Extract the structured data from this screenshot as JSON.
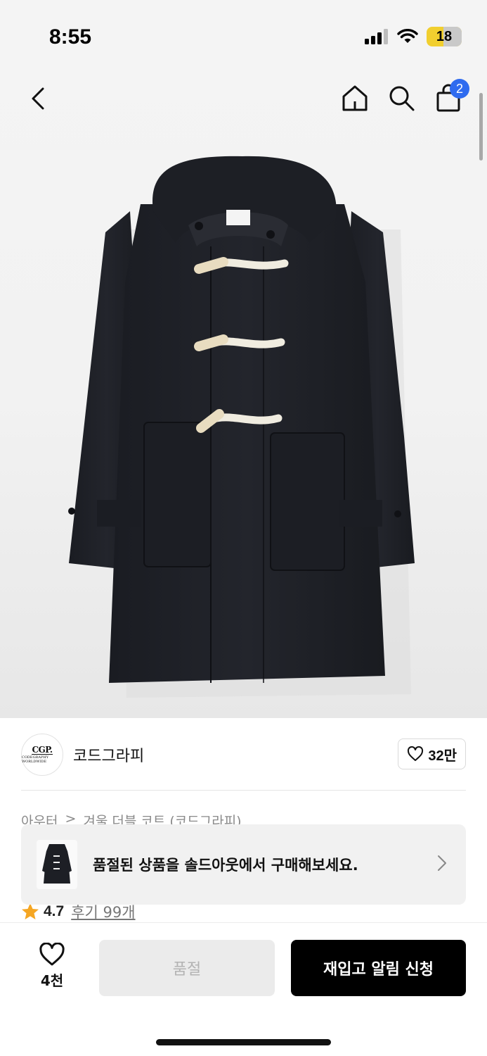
{
  "status_bar": {
    "time": "8:55",
    "battery": "18",
    "icons": [
      "cellular-signal-icon",
      "wifi-icon",
      "battery-icon"
    ]
  },
  "nav": {
    "back_icon": "chevron-left-icon",
    "home_icon": "home-icon",
    "search_icon": "search-icon",
    "bag_icon": "shopping-bag-icon",
    "cart_count": "2"
  },
  "product_image": {
    "icon": "duffle-coat-image"
  },
  "brand": {
    "logo_text": "CGP.",
    "logo_sub": "CODEGRAPHY WORLDWIDE",
    "name": "코드그라피",
    "like_count": "32만",
    "like_icon": "heart-outline-icon"
  },
  "breadcrumb": {
    "category": "아우터",
    "separator": ">",
    "product": "겨울 더블 코트 (코드그라피)"
  },
  "toast": {
    "message": "품절된 상품을 솔드아웃에서 구매해보세요.",
    "chevron_icon": "chevron-right-icon"
  },
  "rating": {
    "star_icon": "star-icon",
    "value": "4.7",
    "reviews": "후기 99개"
  },
  "bottom_bar": {
    "wish_count": "4천",
    "soldout_label": "품절",
    "restock_label": "재입고 알림 신청"
  },
  "colors": {
    "accent_badge": "#2f6bef",
    "primary_button": "#000000",
    "disabled_button": "#ebebeb",
    "star": "#f5a623",
    "battery_low": "#f1cf2f"
  }
}
